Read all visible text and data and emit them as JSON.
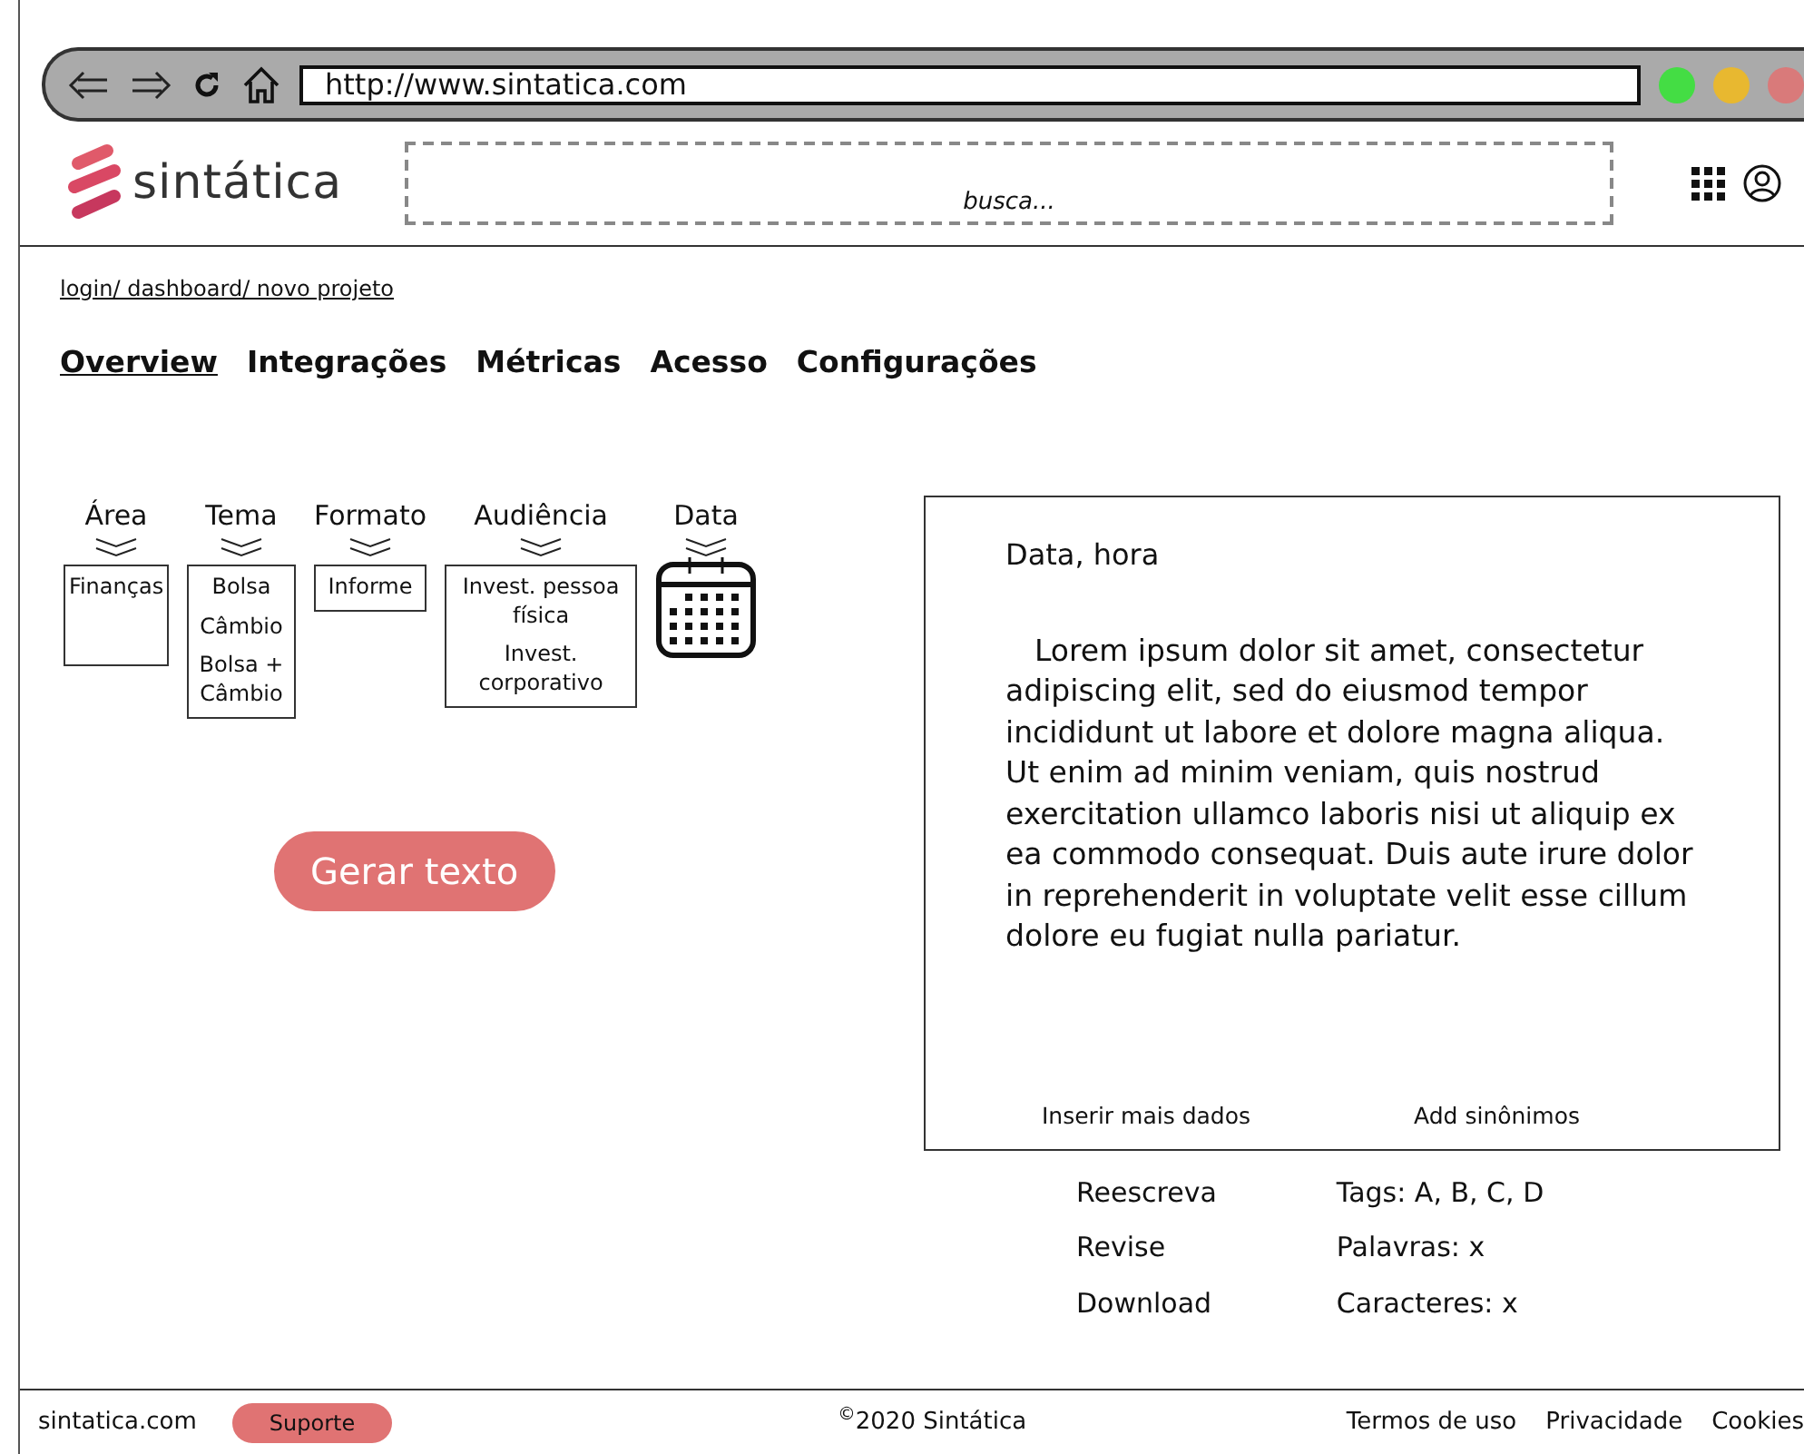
{
  "browser": {
    "url": "http://www.sintatica.com"
  },
  "header": {
    "logo": "sintática",
    "search": {
      "placeholder": "busca..."
    }
  },
  "breadcrumb": "login/ dashboard/ novo projeto",
  "tabs": [
    {
      "label": "Overview",
      "selected": true
    },
    {
      "label": "Integrações",
      "selected": false
    },
    {
      "label": "Métricas",
      "selected": false
    },
    {
      "label": "Acesso",
      "selected": false
    },
    {
      "label": "Configurações",
      "selected": false
    }
  ],
  "filters": [
    {
      "kind": "list",
      "label": "Área",
      "options": [
        "Finanças"
      ]
    },
    {
      "kind": "list",
      "label": "Tema",
      "options": [
        "Bolsa",
        "Câmbio",
        "Bolsa + Câmbio"
      ]
    },
    {
      "kind": "list",
      "label": "Formato",
      "options": [
        "Informe"
      ]
    },
    {
      "kind": "list",
      "label": "Audiência",
      "options": [
        "Invest. pessoa física",
        "Invest. corporativo"
      ]
    },
    {
      "kind": "date",
      "label": "Data"
    }
  ],
  "generate_button": "Gerar texto",
  "output": {
    "heading": "Data, hora",
    "body": "Lorem ipsum dolor sit amet, consectetur adipiscing elit, sed do eiusmod tempor incididunt ut labore et dolore magna aliqua. Ut enim ad minim veniam, quis nostrud exercitation ullamco laboris nisi ut aliquip ex ea commodo consequat. Duis aute irure dolor in reprehenderit in voluptate velit esse cillum dolore eu fugiat nulla pariatur.",
    "links": [
      "Inserir mais dados",
      "Add sinônimos"
    ]
  },
  "actions": [
    "Reescreva",
    "Revise",
    "Download"
  ],
  "stats": [
    "Tags: A, B, C, D",
    "Palavras: x",
    "Caracteres: x"
  ],
  "footer": {
    "site": "sintatica.com",
    "support": "Suporte",
    "copyright": "$^{©}$2020 Sintática",
    "links": [
      "Termos de uso",
      "Privacidade",
      "Cookies"
    ]
  }
}
